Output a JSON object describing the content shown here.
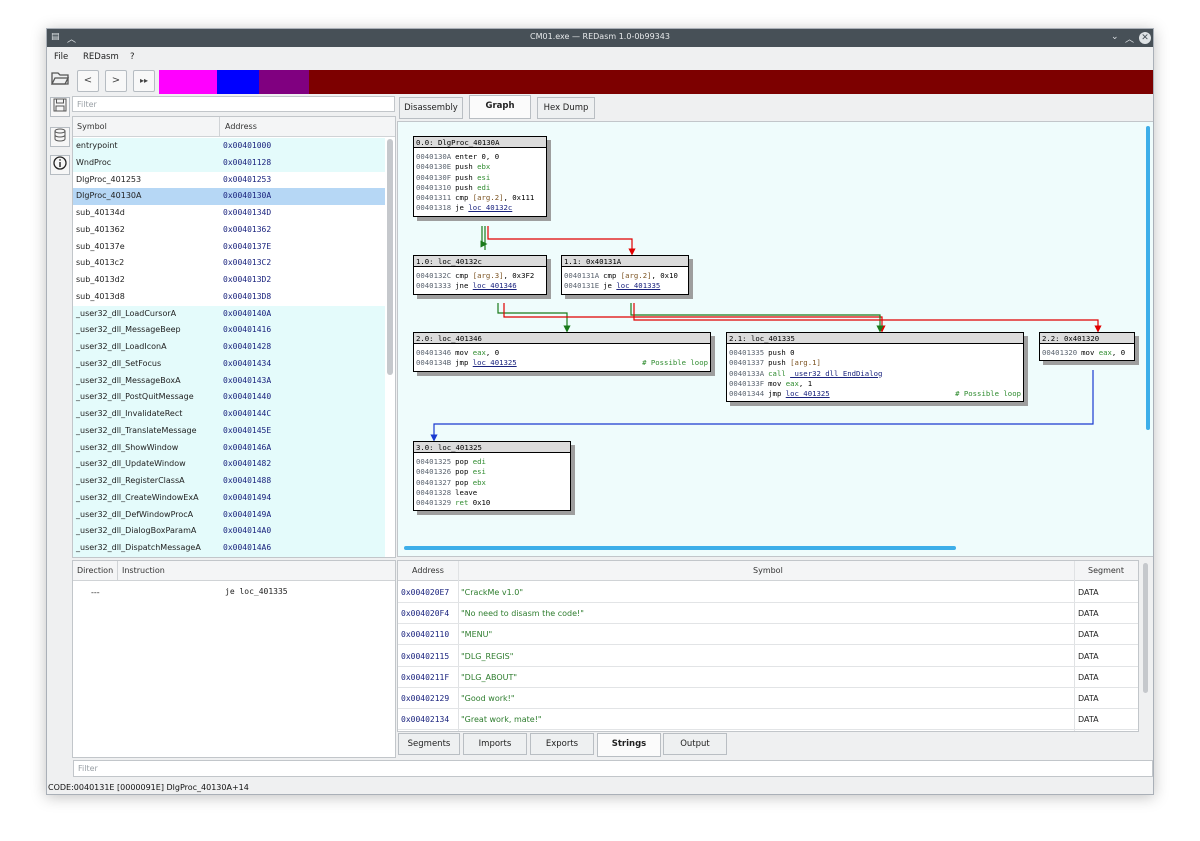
{
  "window": {
    "title": "CM01.exe — REDasm 1.0-0b99343"
  },
  "menu": [
    "File",
    "REDasm",
    "?"
  ],
  "toolbar": {
    "open_icon": "folder-open-icon",
    "back": "<",
    "forward": ">",
    "goto": "▸▸"
  },
  "segment_bar": {
    "colors": [
      "#ff00ff",
      "#0000ff",
      "#800080",
      "#7d0000"
    ]
  },
  "sidebar": {
    "icons": [
      "save-icon",
      "database-icon",
      "info-icon"
    ]
  },
  "symbols": {
    "filter_placeholder": "Filter",
    "headers": {
      "symbol": "Symbol",
      "address": "Address"
    },
    "rows": [
      {
        "name": "entrypoint",
        "address": "0x00401000"
      },
      {
        "name": "WndProc",
        "address": "0x00401128"
      },
      {
        "name": "DlgProc_401253",
        "address": "0x00401253"
      },
      {
        "name": "DlgProc_40130A",
        "address": "0x0040130A"
      },
      {
        "name": "sub_40134d",
        "address": "0x0040134D"
      },
      {
        "name": "sub_401362",
        "address": "0x00401362"
      },
      {
        "name": "sub_40137e",
        "address": "0x0040137E"
      },
      {
        "name": "sub_4013c2",
        "address": "0x004013C2"
      },
      {
        "name": "sub_4013d2",
        "address": "0x004013D2"
      },
      {
        "name": "sub_4013d8",
        "address": "0x004013D8"
      },
      {
        "name": "_user32_dll_LoadCursorA",
        "address": "0x0040140A"
      },
      {
        "name": "_user32_dll_MessageBeep",
        "address": "0x00401416"
      },
      {
        "name": "_user32_dll_LoadIconA",
        "address": "0x00401428"
      },
      {
        "name": "_user32_dll_SetFocus",
        "address": "0x00401434"
      },
      {
        "name": "_user32_dll_MessageBoxA",
        "address": "0x0040143A"
      },
      {
        "name": "_user32_dll_PostQuitMessage",
        "address": "0x00401440"
      },
      {
        "name": "_user32_dll_InvalidateRect",
        "address": "0x0040144C"
      },
      {
        "name": "_user32_dll_TranslateMessage",
        "address": "0x0040145E"
      },
      {
        "name": "_user32_dll_ShowWindow",
        "address": "0x0040146A"
      },
      {
        "name": "_user32_dll_UpdateWindow",
        "address": "0x00401482"
      },
      {
        "name": "_user32_dll_RegisterClassA",
        "address": "0x00401488"
      },
      {
        "name": "_user32_dll_CreateWindowExA",
        "address": "0x00401494"
      },
      {
        "name": "_user32_dll_DefWindowProcA",
        "address": "0x0040149A"
      },
      {
        "name": "_user32_dll_DialogBoxParamA",
        "address": "0x004014A0"
      },
      {
        "name": "_user32_dll_DispatchMessageA",
        "address": "0x004014A6"
      }
    ]
  },
  "instructions": {
    "headers": {
      "direction": "Direction",
      "instruction": "Instruction"
    },
    "rows": [
      {
        "direction": "---",
        "instruction": "je loc_401335"
      }
    ]
  },
  "tabs_top": [
    "Disassembly",
    "Graph",
    "Hex Dump"
  ],
  "graph": {
    "nodes": [
      {
        "title": "0.0: DlgProc_40130A",
        "lines": [
          [
            [
              "ad",
              "0040130A"
            ],
            [
              "mn",
              "enter 0, 0"
            ]
          ],
          [
            [
              "ad",
              "0040130E"
            ],
            [
              "mn",
              "push "
            ],
            [
              "rg",
              "ebx"
            ]
          ],
          [
            [
              "ad",
              "0040130F"
            ],
            [
              "mn",
              "push "
            ],
            [
              "rg",
              "esi"
            ]
          ],
          [
            [
              "ad",
              "00401310"
            ],
            [
              "mn",
              "push "
            ],
            [
              "rg",
              "edi"
            ]
          ],
          [
            [
              "ad",
              "00401311"
            ],
            [
              "mn",
              "cmp "
            ],
            [
              "ar",
              "[arg.2]"
            ],
            [
              "mn",
              ", 0x111"
            ]
          ],
          [
            [
              "ad",
              "00401318"
            ],
            [
              "mn",
              "je "
            ],
            [
              "lk",
              "loc_40132c"
            ]
          ]
        ]
      },
      {
        "title": "1.0: loc_40132c",
        "lines": [
          [
            [
              "ad",
              "0040132C"
            ],
            [
              "mn",
              "cmp "
            ],
            [
              "ar",
              "[arg.3]"
            ],
            [
              "mn",
              ", 0x3F2"
            ]
          ],
          [
            [
              "ad",
              "00401333"
            ],
            [
              "mn",
              "jne "
            ],
            [
              "lk",
              "loc_401346"
            ]
          ]
        ]
      },
      {
        "title": "1.1: 0x40131A",
        "lines": [
          [
            [
              "ad",
              "0040131A"
            ],
            [
              "mn",
              "cmp "
            ],
            [
              "ar",
              "[arg.2]"
            ],
            [
              "mn",
              ", 0x10"
            ]
          ],
          [
            [
              "ad",
              "0040131E"
            ],
            [
              "mn",
              "je "
            ],
            [
              "lk",
              "loc_401335"
            ]
          ]
        ]
      },
      {
        "title": "2.0: loc_401346",
        "lines": [
          [
            [
              "ad",
              "00401346"
            ],
            [
              "mn",
              "mov "
            ],
            [
              "rg",
              "eax"
            ],
            [
              "mn",
              ", 0"
            ]
          ],
          [
            [
              "ad",
              "0040134B"
            ],
            [
              "mn",
              "jmp "
            ],
            [
              "lk",
              "loc_401325"
            ],
            [
              "cm",
              "# Possible loop"
            ]
          ]
        ]
      },
      {
        "title": "2.1: loc_401335",
        "lines": [
          [
            [
              "ad",
              "00401335"
            ],
            [
              "mn",
              "push 0"
            ]
          ],
          [
            [
              "ad",
              "00401337"
            ],
            [
              "mn",
              "push "
            ],
            [
              "ar",
              "[arg.1]"
            ]
          ],
          [
            [
              "ad",
              "0040133A"
            ],
            [
              "rg",
              "call "
            ],
            [
              "lk",
              "_user32_dll_EndDialog"
            ]
          ],
          [
            [
              "ad",
              "0040133F"
            ],
            [
              "mn",
              "mov "
            ],
            [
              "rg",
              "eax"
            ],
            [
              "mn",
              ", 1"
            ]
          ],
          [
            [
              "ad",
              "00401344"
            ],
            [
              "mn",
              "jmp "
            ],
            [
              "lk",
              "loc_401325"
            ],
            [
              "cm",
              "# Possible loop"
            ]
          ]
        ]
      },
      {
        "title": "2.2: 0x401320",
        "lines": [
          [
            [
              "ad",
              "00401320"
            ],
            [
              "mn",
              "mov "
            ],
            [
              "rg",
              "eax"
            ],
            [
              "mn",
              ", 0"
            ]
          ]
        ]
      },
      {
        "title": "3.0: loc_401325",
        "lines": [
          [
            [
              "ad",
              "00401325"
            ],
            [
              "mn",
              "pop "
            ],
            [
              "rg",
              "edi"
            ]
          ],
          [
            [
              "ad",
              "00401326"
            ],
            [
              "mn",
              "pop "
            ],
            [
              "rg",
              "esi"
            ]
          ],
          [
            [
              "ad",
              "00401327"
            ],
            [
              "mn",
              "pop "
            ],
            [
              "rg",
              "ebx"
            ]
          ],
          [
            [
              "ad",
              "00401328"
            ],
            [
              "mn",
              "leave"
            ]
          ],
          [
            [
              "ad",
              "00401329"
            ],
            [
              "rg",
              "ret "
            ],
            [
              "mn",
              "0x10"
            ]
          ]
        ]
      }
    ],
    "edge_colors": {
      "true": "#1a7a1a",
      "false": "#e00000",
      "jump": "#1a3ad0"
    }
  },
  "strings": {
    "headers": {
      "address": "Address",
      "symbol": "Symbol",
      "segment": "Segment"
    },
    "rows": [
      {
        "address": "0x004020E7",
        "symbol": "\"CrackMe v1.0\"",
        "segment": "DATA"
      },
      {
        "address": "0x004020F4",
        "symbol": "\"No need to disasm the code!\"",
        "segment": "DATA"
      },
      {
        "address": "0x00402110",
        "symbol": "\"MENU\"",
        "segment": "DATA"
      },
      {
        "address": "0x00402115",
        "symbol": "\"DLG_REGIS\"",
        "segment": "DATA"
      },
      {
        "address": "0x0040211F",
        "symbol": "\"DLG_ABOUT\"",
        "segment": "DATA"
      },
      {
        "address": "0x00402129",
        "symbol": "\"Good work!\"",
        "segment": "DATA"
      },
      {
        "address": "0x00402134",
        "symbol": "\"Great work, mate!\"",
        "segment": "DATA"
      }
    ]
  },
  "tabs_bottom": [
    "Segments",
    "Imports",
    "Exports",
    "Strings",
    "Output"
  ],
  "bottom_filter_placeholder": "Filter",
  "status": "CODE:0040131E [0000091E] DlgProc_40130A+14"
}
